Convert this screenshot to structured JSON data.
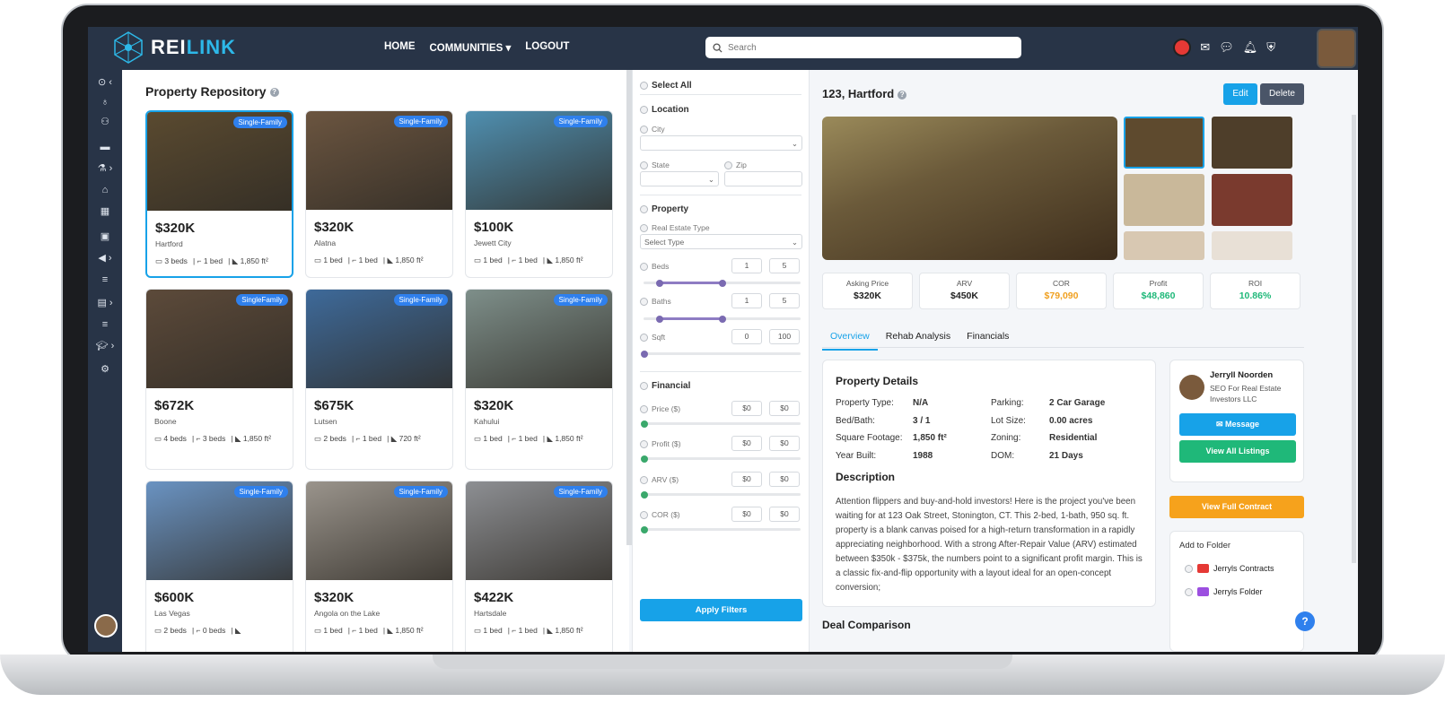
{
  "app": {
    "brand_a": "REI",
    "brand_b": "LINK"
  },
  "nav": {
    "items": [
      {
        "label": "HOME"
      },
      {
        "label": "COMMUNITIES"
      },
      {
        "label": "LOGOUT"
      }
    ],
    "search_placeholder": "Search"
  },
  "repo": {
    "title": "Property Repository",
    "cards": [
      {
        "price": "$320K",
        "city": "Hartford",
        "tag": "Single-Family",
        "beds": "3 beds",
        "baths": "1 bed",
        "sqft": "1,850 ft²",
        "photo": "#5a4a30"
      },
      {
        "price": "$320K",
        "city": "Alatna",
        "tag": "Single-Family",
        "beds": "1 bed",
        "baths": "1 bed",
        "sqft": "1,850 ft²",
        "photo": "#6b5540"
      },
      {
        "price": "$100K",
        "city": "Jewett City",
        "tag": "Single-Family",
        "beds": "1 bed",
        "baths": "1 bed",
        "sqft": "1,850 ft²",
        "photo": "#4f8fb0"
      },
      {
        "price": "$672K",
        "city": "Boone",
        "tag": "SingleFamily",
        "beds": "4 beds",
        "baths": "3 beds",
        "sqft": "1,850 ft²",
        "photo": "#5c4a3a"
      },
      {
        "price": "$675K",
        "city": "Lutsen",
        "tag": "Single-Family",
        "beds": "2 beds",
        "baths": "1 bed",
        "sqft": "720 ft²",
        "photo": "#3e6a9a"
      },
      {
        "price": "$320K",
        "city": "Kahului",
        "tag": "Single-Family",
        "beds": "1 bed",
        "baths": "1 bed",
        "sqft": "1,850 ft²",
        "photo": "#7e8f8a"
      },
      {
        "price": "$600K",
        "city": "Las Vegas",
        "tag": "Single-Family",
        "beds": "2 beds",
        "baths": "0 beds",
        "sqft": "",
        "photo": "#6a93c2"
      },
      {
        "price": "$320K",
        "city": "Angola on the Lake",
        "tag": "Single-Family",
        "beds": "1 bed",
        "baths": "1 bed",
        "sqft": "1,850 ft²",
        "photo": "#9a948c"
      },
      {
        "price": "$422K",
        "city": "Hartsdale",
        "tag": "Single-Family",
        "beds": "1 bed",
        "baths": "1 bed",
        "sqft": "1,850 ft²",
        "photo": "#8d8f93"
      }
    ]
  },
  "filters": {
    "select_all": "Select All",
    "location": "Location",
    "city": "City",
    "state": "State",
    "zip": "Zip",
    "property": "Property",
    "re_type": "Real Estate Type",
    "re_type_value": "Select Type",
    "beds": "Beds",
    "beds_min": "1",
    "beds_max": "5",
    "baths": "Baths",
    "baths_min": "1",
    "baths_max": "5",
    "sqft": "Sqft",
    "sqft_min": "0",
    "sqft_max": "100",
    "financial": "Financial",
    "price": "Price ($)",
    "profit": "Profit ($)",
    "arv": "ARV ($)",
    "cor": "COR ($)",
    "zero": "$0",
    "dash": "-",
    "apply": "Apply Filters"
  },
  "detail": {
    "title": "123, Hartford",
    "edit": "Edit",
    "delete": "Delete",
    "stats": [
      {
        "label": "Asking Price",
        "value": "$320K",
        "color": "#222"
      },
      {
        "label": "ARV",
        "value": "$450K",
        "color": "#222"
      },
      {
        "label": "COR",
        "value": "$79,090",
        "color": "#f0a020"
      },
      {
        "label": "Profit",
        "value": "$48,860",
        "color": "#1fb879"
      },
      {
        "label": "ROI",
        "value": "10.86%",
        "color": "#1fb879"
      }
    ],
    "tabs": [
      "Overview",
      "Rehab Analysis",
      "Financials"
    ],
    "pd_title": "Property Details",
    "kv": [
      {
        "k": "Property Type:",
        "v": "N/A"
      },
      {
        "k": "Parking:",
        "v": "2 Car Garage"
      },
      {
        "k": "Bed/Bath:",
        "v": "3 / 1"
      },
      {
        "k": "Lot Size:",
        "v": "0.00 acres"
      },
      {
        "k": "Square Footage:",
        "v": "1,850 ft²"
      },
      {
        "k": "Zoning:",
        "v": "Residential"
      },
      {
        "k": "Year Built:",
        "v": "1988"
      },
      {
        "k": "DOM:",
        "v": "21 Days"
      }
    ],
    "desc_title": "Description",
    "desc": "Attention flippers and buy-and-hold investors! Here is the project you've been waiting for at 123 Oak Street, Stonington, CT. This 2-bed, 1-bath, 950 sq. ft. property is a blank canvas poised for a high-return transformation in a rapidly appreciating neighborhood. With a strong After-Repair Value (ARV) estimated between $350k - $375k, the numbers point to a significant profit margin. This is a classic fix-and-flip opportunity with a layout ideal for an open-concept conversion;",
    "deal": "Deal Comparison",
    "agent": {
      "name": "Jerryll Noorden",
      "company": "SEO For Real Estate Investors LLC",
      "message": "Message",
      "view_all": "View All Listings"
    },
    "contract": "View Full Contract",
    "folder": {
      "title": "Add to Folder",
      "items": [
        {
          "label": "Jerryls Contracts",
          "color": "#e53935"
        },
        {
          "label": "Jerryls Folder",
          "color": "#9c4fe0"
        }
      ]
    },
    "help": "?"
  }
}
